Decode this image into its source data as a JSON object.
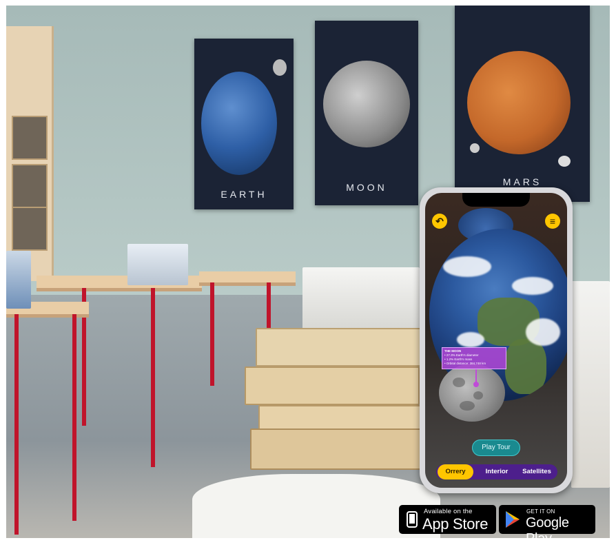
{
  "posters": [
    {
      "name": "EARTH",
      "color": "#2f5fa8"
    },
    {
      "name": "MOON",
      "color": "#9a9a9a"
    },
    {
      "name": "MARS",
      "color": "#c4682a"
    }
  ],
  "app": {
    "back_icon": "undo-arrow-icon",
    "menu_icon": "menu-lines-icon",
    "info_box": {
      "title": "THE MOON",
      "lines": [
        "• 27.3% Earth's diameter",
        "• 1.2% Earth's mass",
        "• Orbital distance: 384,748 km"
      ]
    },
    "play_tour_label": "Play Tour",
    "tabs": [
      {
        "label": "Orrery",
        "active": true
      },
      {
        "label": "Interior",
        "active": false
      },
      {
        "label": "Satellites",
        "active": false
      }
    ],
    "accent": "#ffc600",
    "tabbar_color": "#4d1f8c",
    "button_color": "#1a8a8f"
  },
  "store_badges": {
    "app_store": {
      "small": "Available on the",
      "big": "App Store",
      "icon": "apple-icon"
    },
    "google_play": {
      "small": "GET IT ON",
      "big": "Google Play",
      "icon": "play-triangle-icon"
    }
  }
}
